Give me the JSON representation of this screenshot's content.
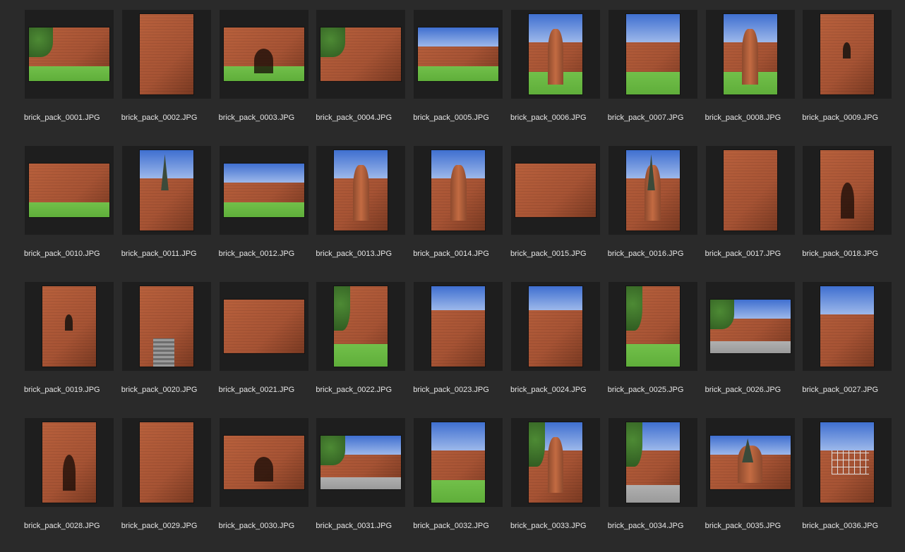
{
  "colors": {
    "background": "#2a2a2a",
    "thumb_frame": "#1e1e1e",
    "caption_text": "#e6e6e6",
    "sky": "#4f7fd6",
    "brick": "#a65334",
    "grass": "#5fae3a",
    "tree": "#2f5a21",
    "ground": "#9a9a9a"
  },
  "files": [
    {
      "name": "brick_pack_0001.JPG",
      "orientation": "landscape",
      "scene": "lamp"
    },
    {
      "name": "brick_pack_0002.JPG",
      "orientation": "portrait",
      "scene": "pillar"
    },
    {
      "name": "brick_pack_0003.JPG",
      "orientation": "landscape",
      "scene": "gate"
    },
    {
      "name": "brick_pack_0004.JPG",
      "orientation": "landscape",
      "scene": "wall-tree"
    },
    {
      "name": "brick_pack_0005.JPG",
      "orientation": "landscape",
      "scene": "castle-sky"
    },
    {
      "name": "brick_pack_0006.JPG",
      "orientation": "portrait",
      "scene": "round-tower"
    },
    {
      "name": "brick_pack_0007.JPG",
      "orientation": "portrait",
      "scene": "wall-sky"
    },
    {
      "name": "brick_pack_0008.JPG",
      "orientation": "portrait",
      "scene": "tower-hill"
    },
    {
      "name": "brick_pack_0009.JPG",
      "orientation": "portrait",
      "scene": "brick-window"
    },
    {
      "name": "brick_pack_0010.JPG",
      "orientation": "landscape",
      "scene": "wall-grass"
    },
    {
      "name": "brick_pack_0011.JPG",
      "orientation": "portrait",
      "scene": "spires"
    },
    {
      "name": "brick_pack_0012.JPG",
      "orientation": "landscape",
      "scene": "castle-sky"
    },
    {
      "name": "brick_pack_0013.JPG",
      "orientation": "portrait",
      "scene": "tower-clouds"
    },
    {
      "name": "brick_pack_0014.JPG",
      "orientation": "portrait",
      "scene": "round-tower-sky"
    },
    {
      "name": "brick_pack_0015.JPG",
      "orientation": "landscape",
      "scene": "building"
    },
    {
      "name": "brick_pack_0016.JPG",
      "orientation": "portrait",
      "scene": "church-tower"
    },
    {
      "name": "brick_pack_0017.JPG",
      "orientation": "portrait",
      "scene": "pillar"
    },
    {
      "name": "brick_pack_0018.JPG",
      "orientation": "portrait",
      "scene": "vault"
    },
    {
      "name": "brick_pack_0019.JPG",
      "orientation": "portrait",
      "scene": "brick-window"
    },
    {
      "name": "brick_pack_0020.JPG",
      "orientation": "portrait",
      "scene": "stairs"
    },
    {
      "name": "brick_pack_0021.JPG",
      "orientation": "landscape",
      "scene": "building"
    },
    {
      "name": "brick_pack_0022.JPG",
      "orientation": "portrait",
      "scene": "house-tree"
    },
    {
      "name": "brick_pack_0023.JPG",
      "orientation": "portrait",
      "scene": "gothic"
    },
    {
      "name": "brick_pack_0024.JPG",
      "orientation": "portrait",
      "scene": "gothic"
    },
    {
      "name": "brick_pack_0025.JPG",
      "orientation": "portrait",
      "scene": "well"
    },
    {
      "name": "brick_pack_0026.JPG",
      "orientation": "landscape",
      "scene": "courtyard"
    },
    {
      "name": "brick_pack_0027.JPG",
      "orientation": "portrait",
      "scene": "house-sky"
    },
    {
      "name": "brick_pack_0028.JPG",
      "orientation": "portrait",
      "scene": "door"
    },
    {
      "name": "brick_pack_0029.JPG",
      "orientation": "portrait",
      "scene": "pillar"
    },
    {
      "name": "brick_pack_0030.JPG",
      "orientation": "landscape",
      "scene": "arch"
    },
    {
      "name": "brick_pack_0031.JPG",
      "orientation": "landscape",
      "scene": "street"
    },
    {
      "name": "brick_pack_0032.JPG",
      "orientation": "portrait",
      "scene": "wall-sky"
    },
    {
      "name": "brick_pack_0033.JPG",
      "orientation": "portrait",
      "scene": "tower-tree"
    },
    {
      "name": "brick_pack_0034.JPG",
      "orientation": "portrait",
      "scene": "street"
    },
    {
      "name": "brick_pack_0035.JPG",
      "orientation": "landscape",
      "scene": "church-tower"
    },
    {
      "name": "brick_pack_0036.JPG",
      "orientation": "portrait",
      "scene": "scaffold"
    }
  ]
}
